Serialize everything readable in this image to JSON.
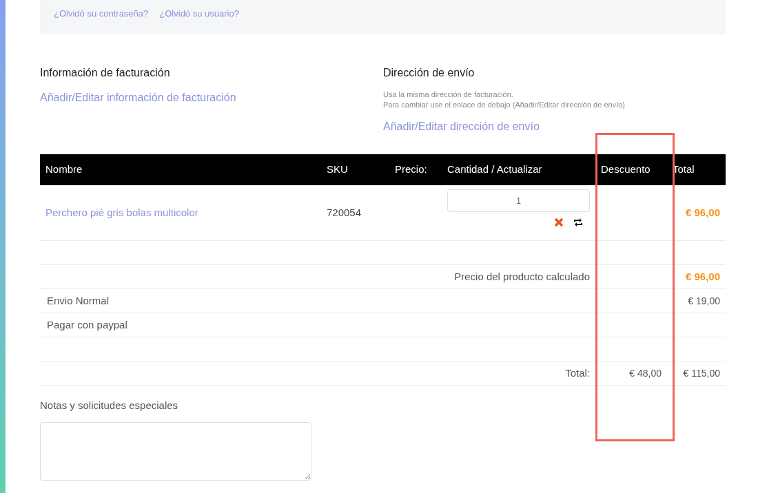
{
  "login_links": [
    "¿Olvidó su contraseña?",
    "¿Olvidó su usuario?"
  ],
  "billing": {
    "title": "Información de facturación",
    "link": "Añadir/Editar información de facturación"
  },
  "shipping": {
    "title": "Dirección de envío",
    "notes": [
      "Usa la misma dirección de facturación.",
      "Para cambiar use el enlace de debajo (Añadir/Editar dirección de envío)"
    ],
    "link": "Añadir/Editar dirección de envío"
  },
  "table": {
    "columns": [
      "Nombre",
      "SKU",
      "Precio:",
      "Cantidad / Actualizar",
      "Descuento",
      "Total"
    ],
    "items": [
      {
        "name": "Perchero pié gris bolas multicolor",
        "sku": "720054",
        "quantity": "1",
        "total": "€ 96,00"
      }
    ],
    "summary_rows": [
      {
        "kind": "blank"
      },
      {
        "kind": "subtotal",
        "label": "Precio del producto calculado",
        "total": "€ 96,00"
      },
      {
        "kind": "line",
        "label": "Envio Normal",
        "total": "€ 19,00"
      },
      {
        "kind": "line",
        "label": "Pagar con paypal"
      },
      {
        "kind": "blank"
      },
      {
        "kind": "total",
        "label": "Total:",
        "discount": "€ 48,00",
        "total": "€ 115,00"
      }
    ]
  },
  "notes": {
    "label": "Notas y solicitudes especiales"
  }
}
